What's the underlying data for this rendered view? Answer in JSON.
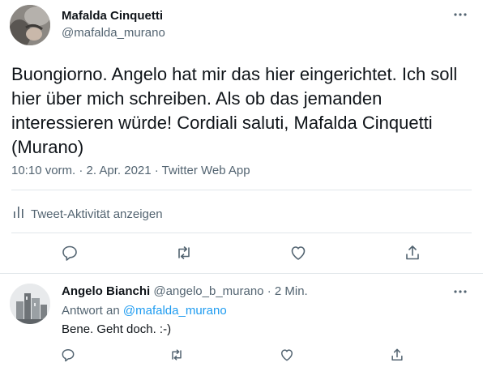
{
  "tweet": {
    "author_name": "Mafalda Cinquetti",
    "author_handle": "@mafalda_murano",
    "text": "Buongiorno. Angelo hat mir das hier eingerichtet. Ich soll hier über mich schreiben. Als ob das jemanden interessieren würde! Cordiali saluti, Mafalda Cinquetti (Murano)",
    "meta": "10:10 vorm. · 2. Apr. 2021 · Twitter Web App",
    "activity_label": "Tweet-Aktivität anzeigen"
  },
  "reply": {
    "author_name": "Angelo Bianchi",
    "author_handle": "@angelo_b_murano",
    "separator": "·",
    "time": "2 Min.",
    "reply_to_prefix": "Antwort an",
    "reply_to_handle": "@mafalda_murano",
    "text": "Bene. Geht doch. :-)"
  },
  "icons": [
    "more-icon",
    "reply-icon",
    "retweet-icon",
    "like-icon",
    "share-icon",
    "analytics-icon"
  ],
  "colors": {
    "text": "#0f1419",
    "secondary": "#536471",
    "link": "#1d9bf0",
    "divider": "#e1e6ea"
  }
}
